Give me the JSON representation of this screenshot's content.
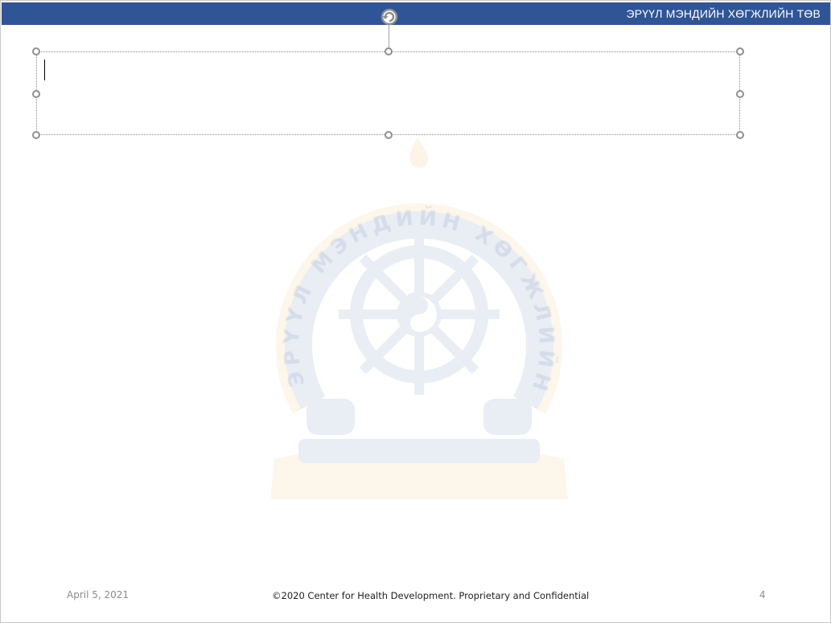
{
  "header": {
    "title": "ЭРҮҮЛ МЭНДИЙН ХӨГЖЛИЙН ТӨВ",
    "bar_color": "#2f5597"
  },
  "watermark": {
    "arc_text": "ЭРҮҮЛ МЭНДИЙН ХӨГЖЛИЙН ТӨВ",
    "symbol": "dharma-wheel-emblem"
  },
  "textbox": {
    "value": "",
    "state": "editing"
  },
  "footer": {
    "date": "April 5, 2021",
    "copyright": "©2020 Center for Health Development. Proprietary and Confidential",
    "page_number": "4"
  },
  "icons": {
    "rotate": "rotate-handle-icon",
    "resize": "resize-handle-icon"
  }
}
